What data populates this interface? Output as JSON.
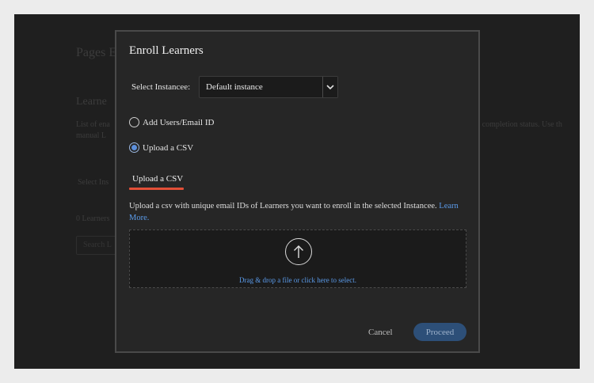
{
  "background": {
    "title": "Pages E",
    "subtitle": "Learne",
    "description_line1": "List of ena",
    "description_line2": "manual L",
    "description_right": "the completion status. Use th",
    "select_label": "Select Ins",
    "count_label": "0 Learners",
    "search_placeholder": "Search L"
  },
  "modal": {
    "title": "Enroll Learners",
    "instance_label": "Select Instancee:",
    "instance_value": "Default instance",
    "options": [
      {
        "label": "Add Users/Email ID",
        "checked": false
      },
      {
        "label": "Upload a CSV",
        "checked": true
      }
    ],
    "tab_label": "Upload a CSV",
    "description": "Upload a csv with unique email IDs of Learners you want to enroll in the selected Instancee.",
    "learn_more": "Learn More.",
    "drop_text": "Drag & drop a file or click here to select.",
    "cancel_label": "Cancel",
    "proceed_label": "Proceed"
  },
  "colors": {
    "accent_underline": "#e34f38",
    "link": "#5b9bea",
    "proceed_bg": "#2d4f78"
  },
  "icons": {
    "upload": "upload-arrow-icon",
    "dropdown": "chevron-down-icon"
  }
}
